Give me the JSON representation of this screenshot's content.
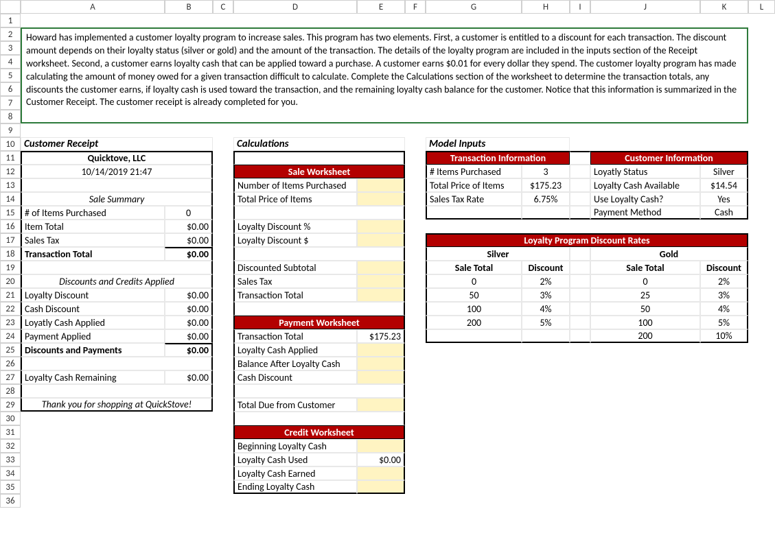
{
  "cols": [
    "A",
    "B",
    "C",
    "D",
    "E",
    "F",
    "G",
    "H",
    "I",
    "J",
    "K",
    "L"
  ],
  "rows": 36,
  "instructions": "Howard has implemented a customer loyalty program to increase sales. This program has two elements. First, a customer is entitled to a discount for each transaction. The discount amount depends on their loyalty status (silver or gold) and the amount of the transaction. The details of the loyalty program are included in the inputs section of the Receipt worksheet. Second, a customer earns loyalty cash that can be applied toward a purchase. A customer earns $0.01 for every dollar they spend. The customer loyalty program has made calculating the amount of money owed for a given transaction difficult to calculate. Complete the Calculations section of the worksheet to determine the transaction totals, any discounts the customer earns, if loyalty cash is used toward the transaction, and the remaining loyalty cash balance for the customer. Notice that this information is summarized in the Customer Receipt. The customer receipt is already completed for you.",
  "receipt": {
    "title": "Customer Receipt",
    "company": "Quicktove, LLC",
    "datetime": "10/14/2019 21:47",
    "sale_summary_hdr": "Sale Summary",
    "rows": {
      "items_label": "# of Items Purchased",
      "items_val": "0",
      "item_total_label": "Item Total",
      "item_total_val": "$0.00",
      "sales_tax_label": "Sales Tax",
      "sales_tax_val": "$0.00",
      "trans_total_label": "Transaction Total",
      "trans_total_val": "$0.00"
    },
    "discounts_hdr": "Discounts and Credits Applied",
    "discounts": {
      "loyalty_disc_label": "Loyalty Discount",
      "loyalty_disc_val": "$0.00",
      "cash_disc_label": "Cash Discount",
      "cash_disc_val": "$0.00",
      "loyalty_cash_label": "Loyatly Cash Applied",
      "loyalty_cash_val": "$0.00",
      "payment_label": "Payment Applied",
      "payment_val": "$0.00",
      "dp_total_label": "Discounts and Payments",
      "dp_total_val": "$0.00"
    },
    "remaining_label": "Loyalty Cash Remaining",
    "remaining_val": "$0.00",
    "thanks": "Thank you for shopping at QuickStove!"
  },
  "calc": {
    "title": "Calculations",
    "sale_hdr": "Sale Worksheet",
    "sale": {
      "num_items": "Number of Items Purchased",
      "total_price": "Total Price of Items",
      "ldp": "Loyalty Discount %",
      "ldd": "Loyalty Discount $",
      "disc_sub": "Discounted Subtotal",
      "sales_tax": "Sales Tax",
      "trans_total": "Transaction Total"
    },
    "pay_hdr": "Payment Worksheet",
    "pay": {
      "trans_total": "Transaction Total",
      "trans_total_val": "$175.23",
      "lca": "Loyalty Cash Applied",
      "balance": "Balance After Loyalty Cash",
      "cash_disc": "Cash Discount",
      "total_due": "Total Due from Customer"
    },
    "credit_hdr": "Credit Worksheet",
    "credit": {
      "begin": "Beginning Loyalty Cash",
      "used": "Loyalty Cash Used",
      "used_val": "$0.00",
      "earned": "Loyalty Cash Earned",
      "ending": "Ending Loyalty Cash"
    }
  },
  "inputs": {
    "title": "Model Inputs",
    "trans_hdr": "Transaction Information",
    "cust_hdr": "Customer Information",
    "trans": {
      "items_label": "# Items Purchased",
      "items_val": "3",
      "total_label": "Total Price of Items",
      "total_val": "$175.23",
      "tax_label": "Sales Tax Rate",
      "tax_val": "6.75%"
    },
    "cust": {
      "status_label": "Loyatly Status",
      "status_val": "Silver",
      "avail_label": "Loyalty Cash Available",
      "avail_val": "$14.54",
      "use_label": "Use Loyalty Cash?",
      "use_val": "Yes",
      "method_label": "Payment Method",
      "method_val": "Cash"
    },
    "rates_hdr": "Loyalty Program Discount Rates",
    "silver": "Silver",
    "gold": "Gold",
    "sale_total": "Sale Total",
    "discount": "Discount",
    "silver_rows": [
      {
        "t": "0",
        "d": "2%"
      },
      {
        "t": "50",
        "d": "3%"
      },
      {
        "t": "100",
        "d": "4%"
      },
      {
        "t": "200",
        "d": "5%"
      }
    ],
    "gold_rows": [
      {
        "t": "0",
        "d": "2%"
      },
      {
        "t": "25",
        "d": "3%"
      },
      {
        "t": "50",
        "d": "4%"
      },
      {
        "t": "100",
        "d": "5%"
      },
      {
        "t": "200",
        "d": "10%"
      }
    ]
  },
  "chart_data": {
    "type": "table",
    "title": "Loyalty Program Discount Rates",
    "series": [
      {
        "name": "Silver",
        "thresholds": [
          0,
          50,
          100,
          200
        ],
        "discounts": [
          0.02,
          0.03,
          0.04,
          0.05
        ]
      },
      {
        "name": "Gold",
        "thresholds": [
          0,
          25,
          50,
          100,
          200
        ],
        "discounts": [
          0.02,
          0.03,
          0.04,
          0.05,
          0.1
        ]
      }
    ]
  }
}
